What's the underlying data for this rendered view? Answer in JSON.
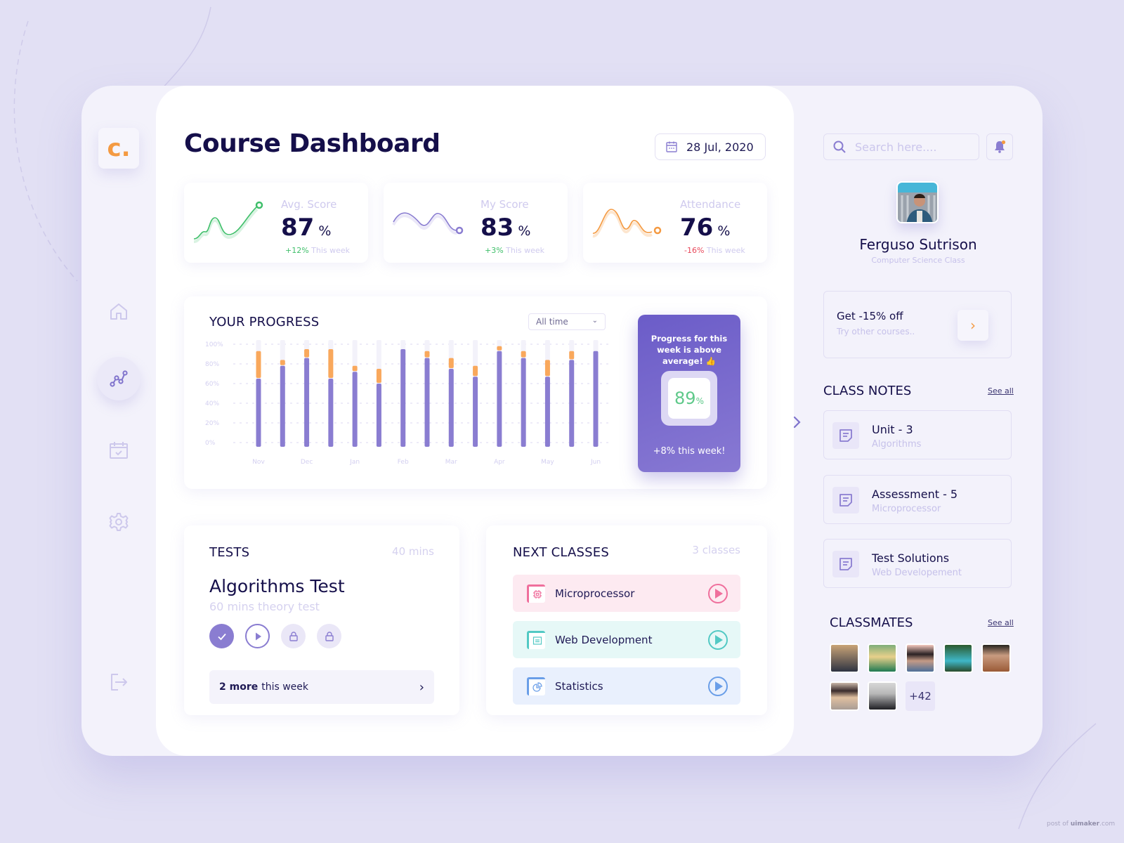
{
  "app": {
    "logo_text": "c.",
    "brand_color": "#f49a42",
    "accent_color": "#8a7dd1"
  },
  "sidebar": {
    "items": [
      {
        "name": "home",
        "icon": "home-icon",
        "active": false
      },
      {
        "name": "progress",
        "icon": "line-chart-icon",
        "active": true
      },
      {
        "name": "schedule",
        "icon": "calendar-check-icon",
        "active": false
      },
      {
        "name": "settings",
        "icon": "gear-icon",
        "active": false
      }
    ],
    "logout_icon": "logout-icon"
  },
  "header": {
    "title": "Course Dashboard",
    "date": "28 Jul, 2020"
  },
  "stats": [
    {
      "label": "Avg. Score",
      "value": "87",
      "unit": "%",
      "change": "+12%",
      "change_suffix": "This week",
      "color": "#3fbf6a",
      "change_color": "#3fbf6a"
    },
    {
      "label": "My Score",
      "value": "83",
      "unit": "%",
      "change": "+3%",
      "change_suffix": "This week",
      "color": "#8a7dd1",
      "change_color": "#3fbf6a"
    },
    {
      "label": "Attendance",
      "value": "76",
      "unit": "%",
      "change": "-16%",
      "change_suffix": "This week",
      "color": "#f49a42",
      "change_color": "#e8475a"
    }
  ],
  "progress": {
    "title": "YOUR PROGRESS",
    "filter": "All time",
    "card": {
      "message": "Progress for this week is above average! 👍",
      "value": "89",
      "unit": "%",
      "weekly": "+8% this week!"
    }
  },
  "chart_data": {
    "type": "bar",
    "stacked": true,
    "title": "YOUR PROGRESS",
    "ylim": [
      0,
      100
    ],
    "yticks": [
      "0%",
      "20%",
      "40%",
      "60%",
      "80%",
      "100%"
    ],
    "xticks": [
      "Nov",
      "Dec",
      "Jan",
      "Feb",
      "Mar",
      "Apr",
      "May",
      "Jun"
    ],
    "grid": true,
    "series": [
      {
        "name": "base",
        "color": "#8a7dd1",
        "values": [
          65,
          78,
          86,
          65,
          72,
          60,
          95,
          86,
          75,
          67,
          93,
          86,
          67,
          84,
          93
        ]
      },
      {
        "name": "extra",
        "color": "#f9a85c",
        "values": [
          28,
          6,
          9,
          30,
          6,
          15,
          0,
          7,
          11,
          11,
          5,
          7,
          17,
          9,
          0
        ]
      }
    ]
  },
  "tests": {
    "title": "TESTS",
    "duration": "40 mins",
    "name": "Algorithms Test",
    "subtitle": "60 mins theory test",
    "steps": [
      "completed",
      "play",
      "locked",
      "locked"
    ],
    "more_bold": "2 more",
    "more_text": "this week"
  },
  "next_classes": {
    "title": "NEXT CLASSES",
    "count": "3 classes",
    "items": [
      {
        "name": "Microprocessor",
        "icon": "chip-icon",
        "bg": "#fdeaf1",
        "color": "#ef6f9c"
      },
      {
        "name": "Web Development",
        "icon": "browser-icon",
        "bg": "#e6f8f7",
        "color": "#52c9c4"
      },
      {
        "name": "Statistics",
        "icon": "pie-chart-icon",
        "bg": "#e9f0fd",
        "color": "#6a9ee8"
      }
    ]
  },
  "right": {
    "search_placeholder": "Search here....",
    "user": {
      "name": "Ferguso Sutrison",
      "class": "Computer Science Class"
    },
    "promo": {
      "title": "Get -15% off",
      "subtitle": "Try other courses.."
    },
    "notes": {
      "title": "CLASS NOTES",
      "see_all": "See all",
      "items": [
        {
          "title": "Unit - 3",
          "subtitle": "Algorithms"
        },
        {
          "title": "Assessment - 5",
          "subtitle": "Microprocessor"
        },
        {
          "title": "Test Solutions",
          "subtitle": "Web Developement"
        }
      ]
    },
    "classmates": {
      "title": "CLASSMATES",
      "see_all": "See all",
      "count_shown": 7,
      "more": "+42"
    }
  },
  "watermark": {
    "prefix": "post of ",
    "brand": "uimaker",
    "suffix": ".com"
  }
}
